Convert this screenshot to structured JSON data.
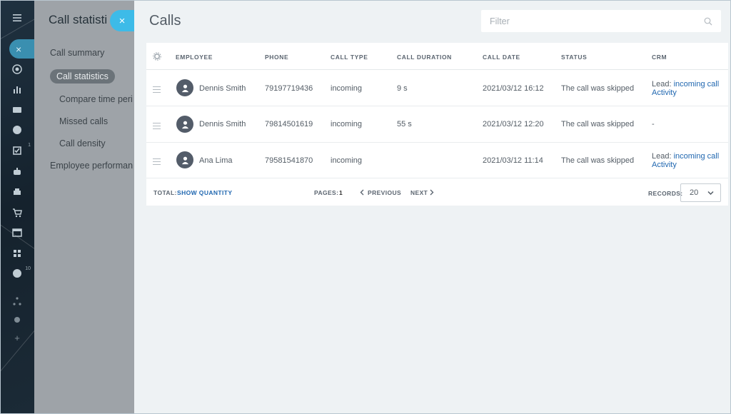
{
  "rail": {
    "items": [
      {
        "icon": "menu-icon"
      },
      {
        "icon": "close-icon"
      },
      {
        "icon": "target-icon"
      },
      {
        "icon": "bar-chart-icon"
      },
      {
        "icon": "mail-icon"
      },
      {
        "icon": "clock-icon"
      },
      {
        "icon": "task-icon",
        "badge": "1"
      },
      {
        "icon": "robot-icon"
      },
      {
        "icon": "printer-icon"
      },
      {
        "icon": "cart-icon"
      },
      {
        "icon": "window-icon"
      },
      {
        "icon": "apps-icon"
      },
      {
        "icon": "heart-icon",
        "badge": "10"
      },
      {
        "icon": "sitemap-icon"
      },
      {
        "icon": "gear-icon"
      },
      {
        "icon": "plus-icon"
      }
    ]
  },
  "background_panel": {
    "title": "Call statisti",
    "menu": [
      {
        "label": "Call summary"
      },
      {
        "label": "Call statistics",
        "active": true
      },
      {
        "label": "Compare time peri"
      },
      {
        "label": "Missed calls"
      },
      {
        "label": "Call density"
      },
      {
        "label": "Employee performan"
      }
    ]
  },
  "close_label": "×",
  "page": {
    "title": "Calls",
    "filter_placeholder": "Filter"
  },
  "grid": {
    "columns": [
      "EMPLOYEE",
      "PHONE",
      "CALL TYPE",
      "CALL DURATION",
      "CALL DATE",
      "STATUS",
      "CRM"
    ],
    "rows": [
      {
        "employee": "Dennis Smith",
        "phone": "79197719436",
        "call_type": "incoming",
        "duration": "9 s",
        "date": "2021/03/12 16:12",
        "status": "The call was skipped",
        "crm_prefix": "Lead: ",
        "crm_link": "incoming call",
        "crm_activity": "Activity"
      },
      {
        "employee": "Dennis Smith",
        "phone": "79814501619",
        "call_type": "incoming",
        "duration": "55 s",
        "date": "2021/03/12 12:20",
        "status": "The call was skipped",
        "crm_plain": "-"
      },
      {
        "employee": "Ana Lima",
        "phone": "79581541870",
        "call_type": "incoming",
        "duration": "",
        "date": "2021/03/12 11:14",
        "status": "The call was skipped",
        "crm_prefix": "Lead: ",
        "crm_link": "incoming call",
        "crm_activity": "Activity"
      }
    ]
  },
  "footer": {
    "total_label": "TOTAL:",
    "show_quantity": "SHOW QUANTITY",
    "pages_label": "PAGES:",
    "page_number": "1",
    "previous": "PREVIOUS",
    "next": "NEXT",
    "records_label": "RECORDS:",
    "records_value": "20"
  },
  "colors": {
    "accent": "#3dbbe8",
    "link": "#2067b0",
    "rail_bg": "#1b2a36"
  }
}
